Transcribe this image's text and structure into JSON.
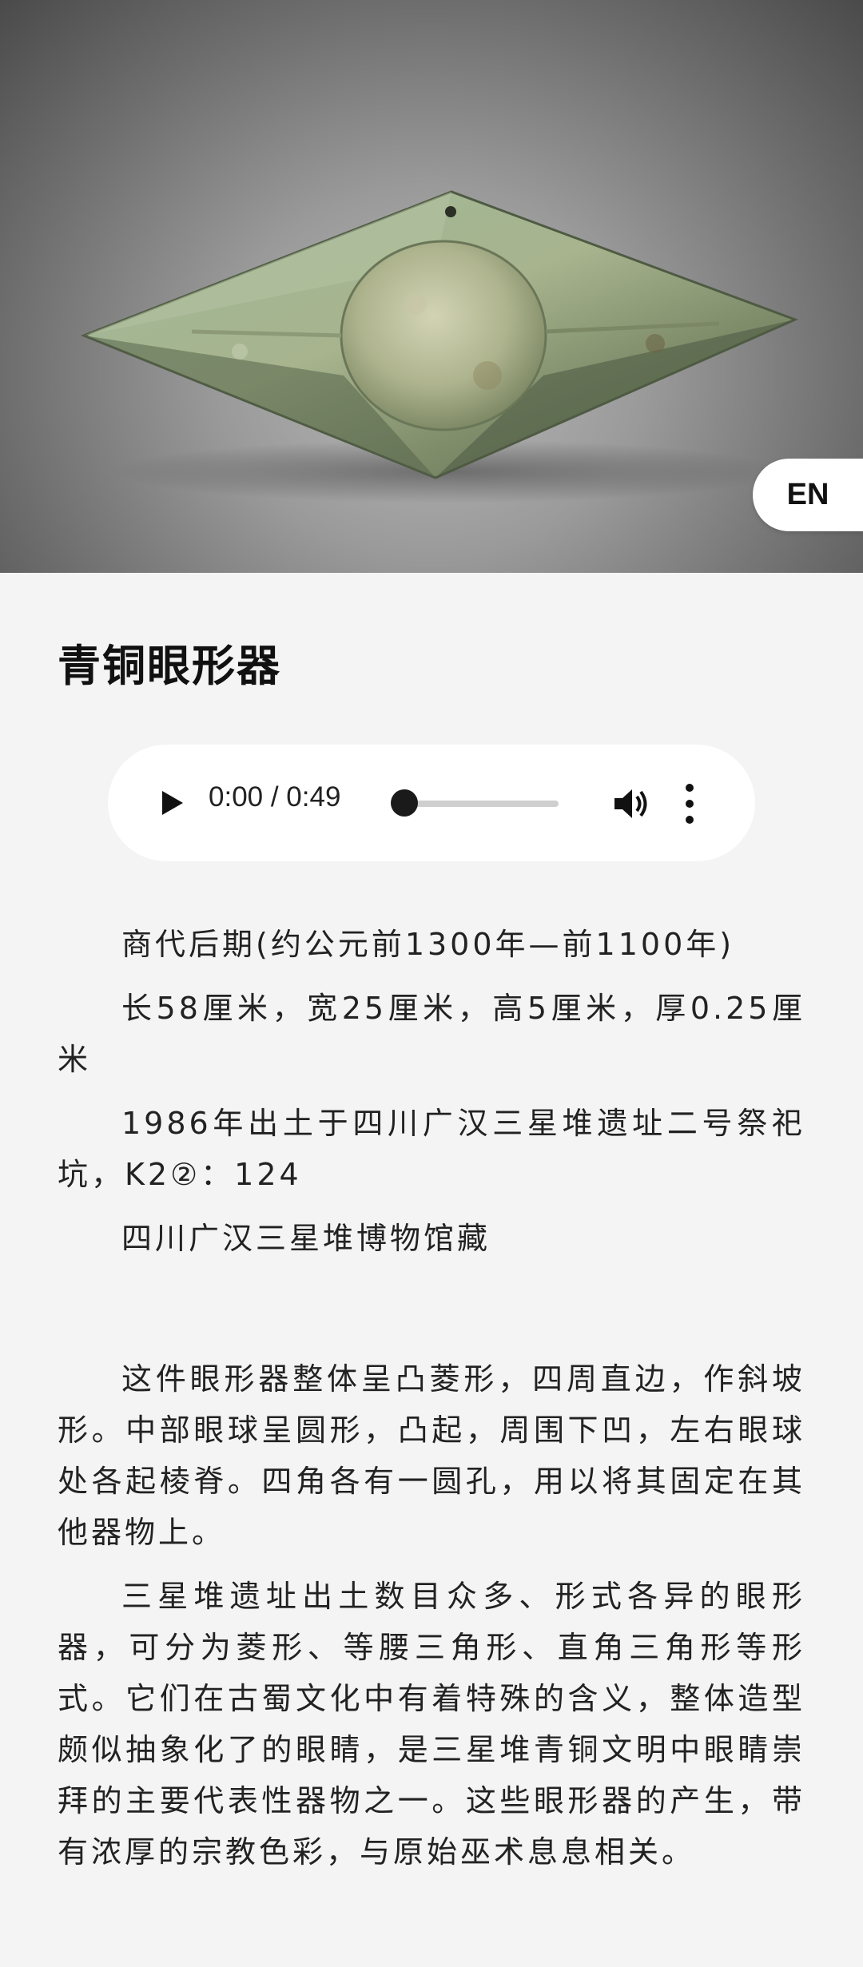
{
  "hero": {
    "image_alt": "青铜眼形器",
    "lang_button": "EN"
  },
  "title": "青铜眼形器",
  "audio": {
    "time": "0:00 / 0:49",
    "progress": 0
  },
  "meta": [
    "商代后期(约公元前1300年—前1100年)",
    "长58厘米，宽25厘米，高5厘米，厚0.25厘米",
    "1986年出土于四川广汉三星堆遗址二号祭祀坑，K2②：124",
    "四川广汉三星堆博物馆藏"
  ],
  "description": [
    "这件眼形器整体呈凸菱形，四周直边，作斜坡形。中部眼球呈圆形，凸起，周围下凹，左右眼球处各起棱脊。四角各有一圆孔，用以将其固定在其他器物上。",
    "三星堆遗址出土数目众多、形式各异的眼形器，可分为菱形、等腰三角形、直角三角形等形式。它们在古蜀文化中有着特殊的含义，整体造型颇似抽象化了的眼睛，是三星堆青铜文明中眼睛崇拜的主要代表性器物之一。这些眼形器的产生，带有浓厚的宗教色彩，与原始巫术息息相关。"
  ]
}
